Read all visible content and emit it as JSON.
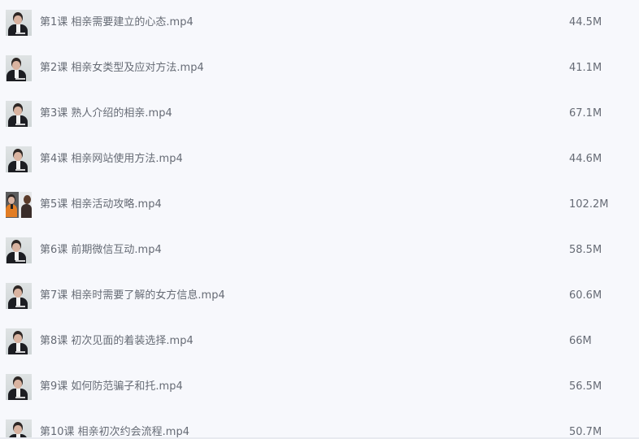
{
  "files": [
    {
      "name": "第1课 相亲需要建立的心态.mp4",
      "size": "44.5M",
      "thumbnail": "lecturer-video-thumbnail"
    },
    {
      "name": "第2课 相亲女类型及应对方法.mp4",
      "size": "41.1M",
      "thumbnail": "lecturer-video-thumbnail"
    },
    {
      "name": "第3课 熟人介绍的相亲.mp4",
      "size": "67.1M",
      "thumbnail": "lecturer-video-thumbnail"
    },
    {
      "name": "第4课 相亲网站使用方法.mp4",
      "size": "44.6M",
      "thumbnail": "lecturer-video-thumbnail"
    },
    {
      "name": "第5课 相亲活动攻略.mp4",
      "size": "102.2M",
      "thumbnail": "two-people-video-thumbnail"
    },
    {
      "name": "第6课 前期微信互动.mp4",
      "size": "58.5M",
      "thumbnail": "lecturer-video-thumbnail"
    },
    {
      "name": "第7课 相亲时需要了解的女方信息.mp4",
      "size": "60.6M",
      "thumbnail": "lecturer-video-thumbnail"
    },
    {
      "name": "第8课 初次见面的着装选择.mp4",
      "size": "66M",
      "thumbnail": "lecturer-video-thumbnail"
    },
    {
      "name": "第9课 如何防范骗子和托.mp4",
      "size": "56.5M",
      "thumbnail": "lecturer-video-thumbnail"
    },
    {
      "name": "第10课 相亲初次约会流程.mp4",
      "size": "50.7M",
      "thumbnail": "lecturer-video-thumbnail"
    }
  ],
  "colors": {
    "background": "#f7f8fc",
    "text": "#666b75"
  }
}
